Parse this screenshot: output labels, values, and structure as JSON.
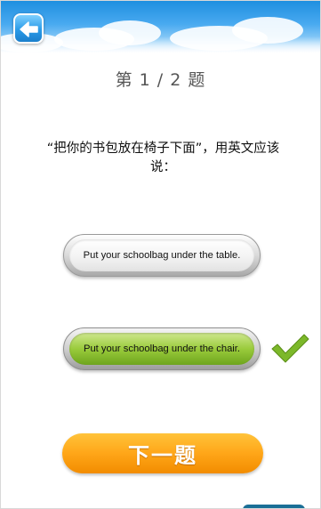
{
  "header": {
    "back_icon": "back-arrow-icon"
  },
  "quiz": {
    "counter": "第 1 / 2 题",
    "question": "“把你的书包放在椅子下面”，用英文应该说：",
    "options": [
      {
        "label": "Put your schoolbag under the table.",
        "selected": false
      },
      {
        "label": "Put your schoolbag under the chair.",
        "selected": true
      }
    ],
    "correct_icon": "checkmark-icon",
    "next_label": "下一题"
  },
  "colors": {
    "sky": "#49aaf0",
    "selected_option": "#9acb3c",
    "next_button": "#ffa618",
    "checkmark": "#7cb82a"
  }
}
